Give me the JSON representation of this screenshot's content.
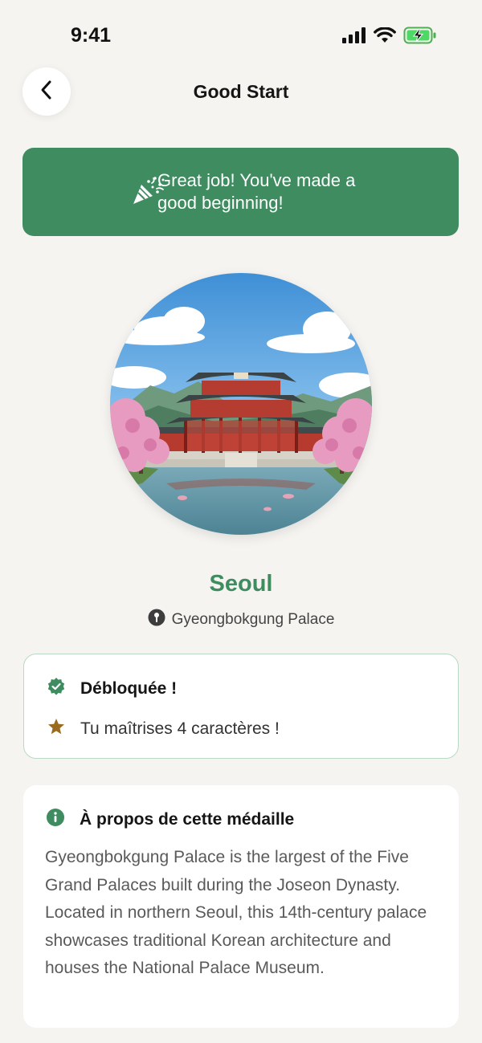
{
  "status_bar": {
    "time": "9:41",
    "icons": [
      "signal-icon",
      "wifi-icon",
      "battery-charging-icon"
    ]
  },
  "header": {
    "title": "Good Start",
    "back_icon": "chevron-left-icon"
  },
  "banner": {
    "icon": "party-popper-icon",
    "message": "Great job! You've made a good beginning!",
    "background_color": "#3e8c60"
  },
  "medal": {
    "image": "gyeongbokgung-palace-illustration",
    "city": "Seoul",
    "location_icon": "map-pin-icon",
    "location": "Gyeongbokgung Palace"
  },
  "unlocked": {
    "status_icon": "verified-badge-icon",
    "title": "Débloquée !",
    "star_icon": "star-icon",
    "achievement": "Tu maîtrises 4 caractères !"
  },
  "about": {
    "icon": "info-icon",
    "title": "À propos de cette médaille",
    "description": "Gyeongbokgung Palace is the largest of the Five Grand Palaces built during the Joseon Dynasty. Located in northern Seoul, this 14th-century palace showcases traditional Korean architecture and houses the National Palace Museum."
  },
  "colors": {
    "accent": "#3e8c60",
    "background": "#f6f4f1",
    "star": "#9a6b1f"
  }
}
